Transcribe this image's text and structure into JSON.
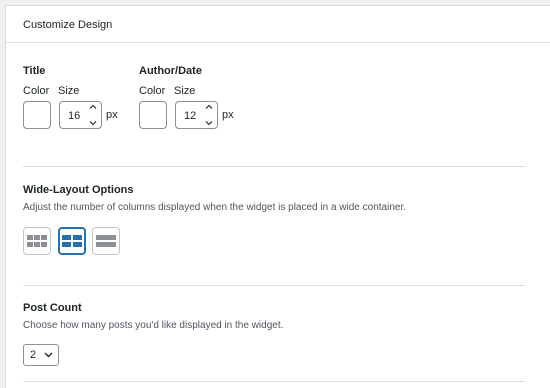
{
  "panel": {
    "title": "Customize Design"
  },
  "title_group": {
    "heading": "Title",
    "color_label": "Color",
    "size_label": "Size",
    "size_value": "16",
    "unit": "px"
  },
  "author_group": {
    "heading": "Author/Date",
    "color_label": "Color",
    "size_label": "Size",
    "size_value": "12",
    "unit": "px"
  },
  "wide_layout": {
    "heading": "Wide-Layout Options",
    "description": "Adjust the number of columns displayed when the widget is placed in a wide container.",
    "options": [
      "grid-3-columns-icon",
      "grid-2-columns-icon",
      "list-1-column-icon"
    ],
    "selected_index": 1
  },
  "post_count": {
    "heading": "Post Count",
    "description": "Choose how many posts you'd like displayed in the widget.",
    "selected_value": "2"
  },
  "colors": {
    "accent": "#2271b1",
    "icon_gray": "#8c8f94",
    "border": "#dcdcde"
  }
}
